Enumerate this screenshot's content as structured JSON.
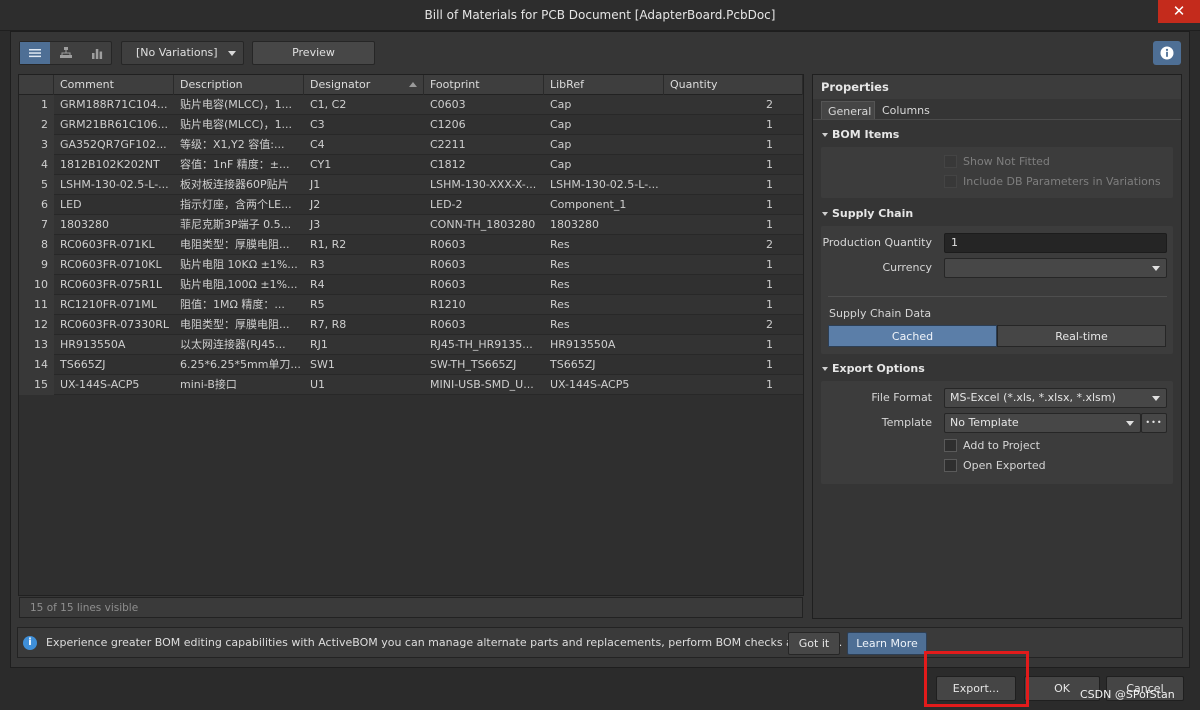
{
  "window": {
    "title": "Bill of Materials for PCB Document [AdapterBoard.PcbDoc]",
    "close_glyph": "✕"
  },
  "toolbar": {
    "variations": "[No Variations]",
    "preview": "Preview"
  },
  "table": {
    "columns": [
      "",
      "Comment",
      "Description",
      "Designator",
      "Footprint",
      "LibRef",
      "Quantity"
    ],
    "sorted_column": "Designator",
    "rows": [
      [
        "1",
        "GRM188R71C104...",
        "贴片电容(MLCC)，1...",
        "C1, C2",
        "C0603",
        "Cap",
        "2"
      ],
      [
        "2",
        "GRM21BR61C106...",
        "贴片电容(MLCC)，1...",
        "C3",
        "C1206",
        "Cap",
        "1"
      ],
      [
        "3",
        "GA352QR7GF102...",
        "等级：X1,Y2 容值:...",
        "C4",
        "C2211",
        "Cap",
        "1"
      ],
      [
        "4",
        "1812B102K202NT",
        "容值：1nF 精度：±...",
        "CY1",
        "C1812",
        "Cap",
        "1"
      ],
      [
        "5",
        "LSHM-130-02.5-L-...",
        "板对板连接器60P贴片",
        "J1",
        "LSHM-130-XXX-X-...",
        "LSHM-130-02.5-L-...",
        "1"
      ],
      [
        "6",
        "LED",
        "指示灯座，含两个LE...",
        "J2",
        "LED-2",
        "Component_1",
        "1"
      ],
      [
        "7",
        "1803280",
        "菲尼克斯3P端子 0.5...",
        "J3",
        "CONN-TH_1803280",
        "1803280",
        "1"
      ],
      [
        "8",
        "RC0603FR-071KL",
        "电阻类型：厚膜电阻...",
        "R1, R2",
        "R0603",
        "Res",
        "2"
      ],
      [
        "9",
        "RC0603FR-0710KL",
        "贴片电阻 10KΩ ±1%...",
        "R3",
        "R0603",
        "Res",
        "1"
      ],
      [
        "10",
        "RC0603FR-075R1L",
        "贴片电阻,100Ω ±1%...",
        "R4",
        "R0603",
        "Res",
        "1"
      ],
      [
        "11",
        "RC1210FR-071ML",
        "阻值：1MΩ 精度：...",
        "R5",
        "R1210",
        "Res",
        "1"
      ],
      [
        "12",
        "RC0603FR-07330RL",
        "电阻类型：厚膜电阻...",
        "R7, R8",
        "R0603",
        "Res",
        "2"
      ],
      [
        "13",
        "HR913550A",
        "以太网连接器(RJ45...",
        "RJ1",
        "RJ45-TH_HR9135...",
        "HR913550A",
        "1"
      ],
      [
        "14",
        "TS665ZJ",
        "6.25*6.25*5mm单刀...",
        "SW1",
        "SW-TH_TS665ZJ",
        "TS665ZJ",
        "1"
      ],
      [
        "15",
        "UX-144S-ACP5",
        "mini-B接口",
        "U1",
        "MINI-USB-SMD_U...",
        "UX-144S-ACP5",
        "1"
      ]
    ],
    "footer": "15 of 15 lines visible"
  },
  "properties": {
    "title": "Properties",
    "tabs": [
      "General",
      "Columns"
    ],
    "active_tab": "General",
    "bom_items": {
      "heading": "BOM Items",
      "show_not_fitted": "Show Not Fitted",
      "include_db": "Include DB Parameters in Variations"
    },
    "supply_chain": {
      "heading": "Supply Chain",
      "production_quantity_label": "Production Quantity",
      "production_quantity": "1",
      "currency_label": "Currency",
      "currency": "",
      "data_label": "Supply Chain Data",
      "cached": "Cached",
      "realtime": "Real-time",
      "selected": "Cached"
    },
    "export_options": {
      "heading": "Export Options",
      "file_format_label": "File Format",
      "file_format": "MS-Excel (*.xls, *.xlsx, *.xlsm)",
      "template_label": "Template",
      "template": "No Template",
      "more_glyph": "•••",
      "add_to_project": "Add to Project",
      "open_exported": "Open Exported"
    }
  },
  "banner": {
    "icon_glyph": "i",
    "text": "Experience greater BOM editing capabilities with ActiveBOM you can manage alternate parts and replacements, perform BOM checks and more.",
    "got_it": "Got it",
    "learn_more": "Learn More"
  },
  "buttons": {
    "export": "Export...",
    "ok": "OK",
    "cancel": "Cancel"
  },
  "watermark": "CSDN @SPofStan",
  "colors": {
    "accent": "#4e6f95",
    "selected_segment": "#5b7ea8",
    "close": "#c42b1c",
    "highlight": "#e21b1b",
    "info_icon": "#3f8fd8"
  }
}
